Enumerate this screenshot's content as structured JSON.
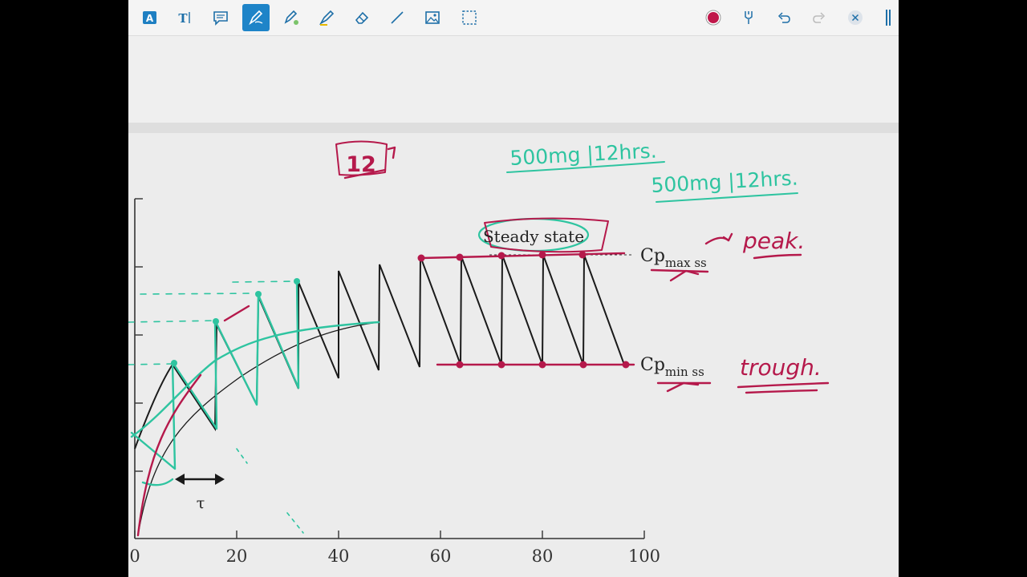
{
  "toolbar": {
    "tools": [
      {
        "name": "text-box-tool",
        "glyph": "A"
      },
      {
        "name": "text-tool",
        "glyph": "T"
      },
      {
        "name": "comment-tool"
      },
      {
        "name": "pen-tool",
        "active": true
      },
      {
        "name": "pencil-tool"
      },
      {
        "name": "highlighter-tool"
      },
      {
        "name": "eraser-tool"
      },
      {
        "name": "line-tool"
      },
      {
        "name": "image-tool"
      },
      {
        "name": "select-tool"
      }
    ],
    "right_tools": [
      {
        "name": "color-picker"
      },
      {
        "name": "pen-settings"
      },
      {
        "name": "undo"
      },
      {
        "name": "redo"
      },
      {
        "name": "close"
      }
    ],
    "active_color": "#c0174a"
  },
  "slide": {
    "steady_state_label": "Steady state",
    "cp_max": "Cp",
    "cp_max_sub": "max ss",
    "cp_min": "Cp",
    "cp_min_sub": "min ss",
    "tau": "τ",
    "x_ticks": [
      "0",
      "20",
      "40",
      "60",
      "80",
      "100"
    ]
  },
  "annotations": {
    "interval_box": "12",
    "note_1": "500mg |12hrs.",
    "note_2": "500mg |12hrs.",
    "peak": "peak.",
    "trough": "trough."
  },
  "colors": {
    "ink_red": "#b5194b",
    "ink_teal": "#2ec4a0",
    "curve_black": "#1a1a1a"
  }
}
